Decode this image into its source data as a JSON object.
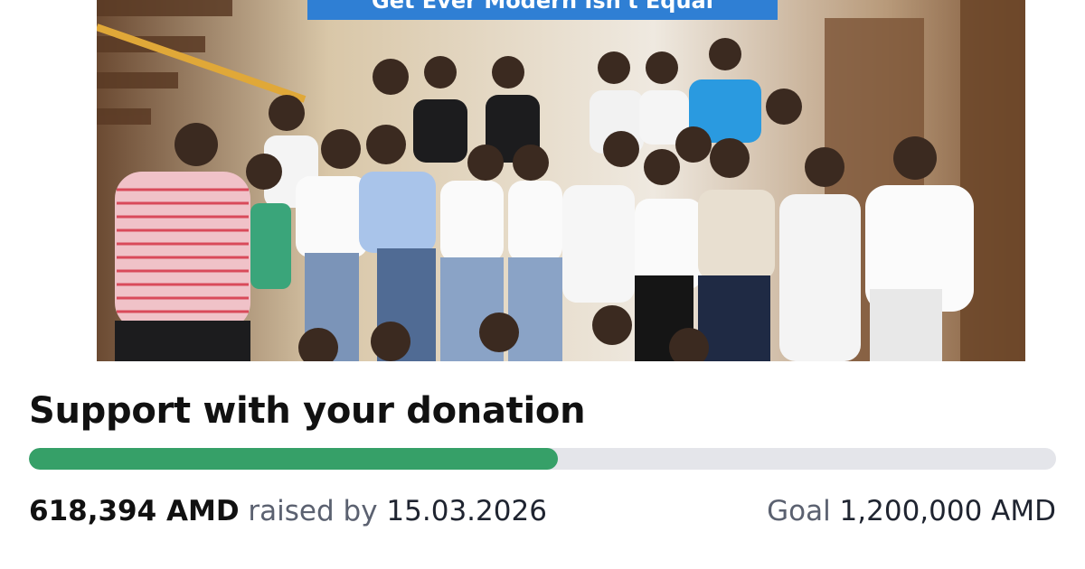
{
  "photo": {
    "alt_subject": "group-photo",
    "banner_text": "Get Ever Modern Isn't Equal"
  },
  "campaign": {
    "title": "Support with your donation",
    "raised_amount": "618,394 AMD",
    "raised_label": "raised by",
    "deadline": "15.03.2026",
    "goal_label": "Goal",
    "goal_amount": "1,200,000 AMD",
    "progress_fraction": 0.5153
  },
  "colors": {
    "progress_fill": "#36a068",
    "progress_track": "#e4e5ea",
    "banner": "#2f7fd4"
  }
}
